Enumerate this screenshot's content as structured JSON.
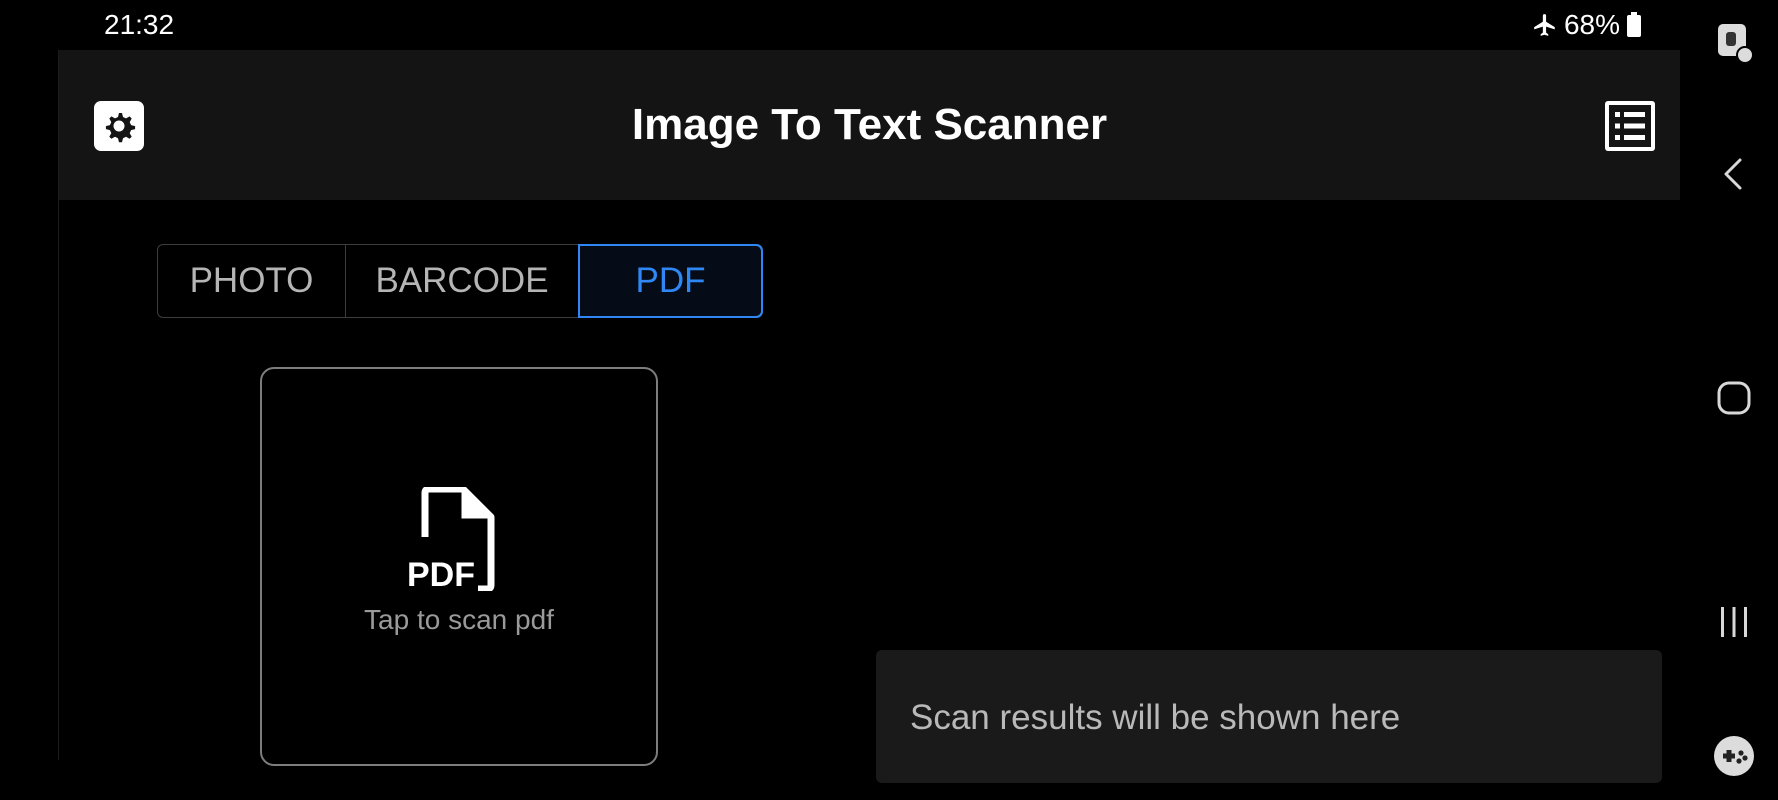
{
  "status_bar": {
    "time": "21:32",
    "battery": "68%",
    "airplane_icon": "airplane-icon",
    "battery_icon": "battery-icon"
  },
  "header": {
    "title": "Image To Text Scanner",
    "settings_icon": "gear-icon",
    "history_icon": "list-icon"
  },
  "tabs": [
    {
      "label": "PHOTO",
      "active": false
    },
    {
      "label": "BARCODE",
      "active": false
    },
    {
      "label": "PDF",
      "active": true
    }
  ],
  "scan_card": {
    "icon_text": "PDF",
    "label": "Tap to scan pdf"
  },
  "results": {
    "placeholder": "Scan results will be shown here"
  },
  "nav_bar": {
    "buttons": [
      "screen-pin-icon",
      "back-icon",
      "home-icon",
      "recents-icon",
      "game-tools-icon"
    ]
  },
  "colors": {
    "accent": "#2f86f5",
    "app_bar": "#141414",
    "background": "#000000",
    "results_panel": "#1a1a1a"
  }
}
